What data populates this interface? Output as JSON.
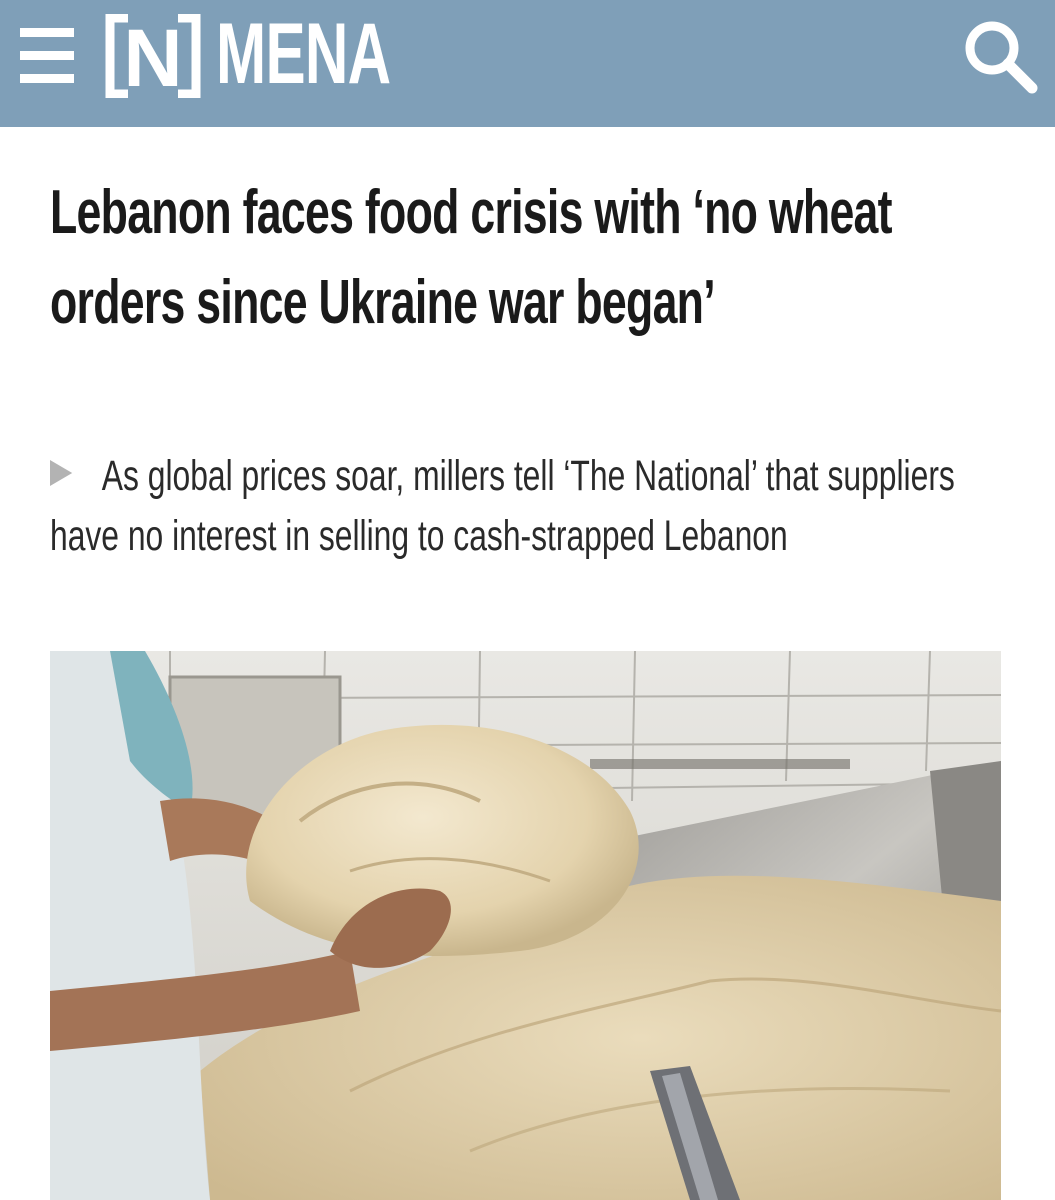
{
  "header": {
    "menu_icon": "hamburger-menu-icon",
    "logo_letter": "N",
    "section": "MENA",
    "search_icon": "search-icon",
    "bar_color": "#7f9fb8"
  },
  "article": {
    "headline": "Lebanon faces food crisis with ‘no wheat orders since Ukraine war began’",
    "subheadline": "As global prices soar, millers tell ‘The National’ that suppliers have no interest in selling to cash-strapped Lebanon",
    "bullet_icon": "triangle-bullet-icon",
    "photo_subject": "baker kneading dough"
  }
}
